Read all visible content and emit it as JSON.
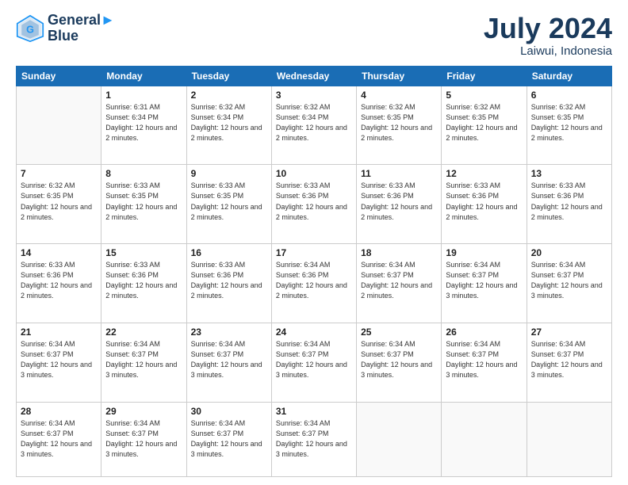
{
  "header": {
    "logo_line1": "General",
    "logo_line2": "Blue",
    "month_year": "July 2024",
    "location": "Laiwui, Indonesia"
  },
  "weekdays": [
    "Sunday",
    "Monday",
    "Tuesday",
    "Wednesday",
    "Thursday",
    "Friday",
    "Saturday"
  ],
  "weeks": [
    [
      {
        "day": "",
        "sunrise": "",
        "sunset": "",
        "daylight": "",
        "empty": true
      },
      {
        "day": "1",
        "sunrise": "6:31 AM",
        "sunset": "6:34 PM",
        "daylight": "12 hours and 2 minutes."
      },
      {
        "day": "2",
        "sunrise": "6:32 AM",
        "sunset": "6:34 PM",
        "daylight": "12 hours and 2 minutes."
      },
      {
        "day": "3",
        "sunrise": "6:32 AM",
        "sunset": "6:34 PM",
        "daylight": "12 hours and 2 minutes."
      },
      {
        "day": "4",
        "sunrise": "6:32 AM",
        "sunset": "6:35 PM",
        "daylight": "12 hours and 2 minutes."
      },
      {
        "day": "5",
        "sunrise": "6:32 AM",
        "sunset": "6:35 PM",
        "daylight": "12 hours and 2 minutes."
      },
      {
        "day": "6",
        "sunrise": "6:32 AM",
        "sunset": "6:35 PM",
        "daylight": "12 hours and 2 minutes."
      }
    ],
    [
      {
        "day": "7",
        "sunrise": "6:32 AM",
        "sunset": "6:35 PM",
        "daylight": "12 hours and 2 minutes."
      },
      {
        "day": "8",
        "sunrise": "6:33 AM",
        "sunset": "6:35 PM",
        "daylight": "12 hours and 2 minutes."
      },
      {
        "day": "9",
        "sunrise": "6:33 AM",
        "sunset": "6:35 PM",
        "daylight": "12 hours and 2 minutes."
      },
      {
        "day": "10",
        "sunrise": "6:33 AM",
        "sunset": "6:36 PM",
        "daylight": "12 hours and 2 minutes."
      },
      {
        "day": "11",
        "sunrise": "6:33 AM",
        "sunset": "6:36 PM",
        "daylight": "12 hours and 2 minutes."
      },
      {
        "day": "12",
        "sunrise": "6:33 AM",
        "sunset": "6:36 PM",
        "daylight": "12 hours and 2 minutes."
      },
      {
        "day": "13",
        "sunrise": "6:33 AM",
        "sunset": "6:36 PM",
        "daylight": "12 hours and 2 minutes."
      }
    ],
    [
      {
        "day": "14",
        "sunrise": "6:33 AM",
        "sunset": "6:36 PM",
        "daylight": "12 hours and 2 minutes."
      },
      {
        "day": "15",
        "sunrise": "6:33 AM",
        "sunset": "6:36 PM",
        "daylight": "12 hours and 2 minutes."
      },
      {
        "day": "16",
        "sunrise": "6:33 AM",
        "sunset": "6:36 PM",
        "daylight": "12 hours and 2 minutes."
      },
      {
        "day": "17",
        "sunrise": "6:34 AM",
        "sunset": "6:36 PM",
        "daylight": "12 hours and 2 minutes."
      },
      {
        "day": "18",
        "sunrise": "6:34 AM",
        "sunset": "6:37 PM",
        "daylight": "12 hours and 2 minutes."
      },
      {
        "day": "19",
        "sunrise": "6:34 AM",
        "sunset": "6:37 PM",
        "daylight": "12 hours and 3 minutes."
      },
      {
        "day": "20",
        "sunrise": "6:34 AM",
        "sunset": "6:37 PM",
        "daylight": "12 hours and 3 minutes."
      }
    ],
    [
      {
        "day": "21",
        "sunrise": "6:34 AM",
        "sunset": "6:37 PM",
        "daylight": "12 hours and 3 minutes."
      },
      {
        "day": "22",
        "sunrise": "6:34 AM",
        "sunset": "6:37 PM",
        "daylight": "12 hours and 3 minutes."
      },
      {
        "day": "23",
        "sunrise": "6:34 AM",
        "sunset": "6:37 PM",
        "daylight": "12 hours and 3 minutes."
      },
      {
        "day": "24",
        "sunrise": "6:34 AM",
        "sunset": "6:37 PM",
        "daylight": "12 hours and 3 minutes."
      },
      {
        "day": "25",
        "sunrise": "6:34 AM",
        "sunset": "6:37 PM",
        "daylight": "12 hours and 3 minutes."
      },
      {
        "day": "26",
        "sunrise": "6:34 AM",
        "sunset": "6:37 PM",
        "daylight": "12 hours and 3 minutes."
      },
      {
        "day": "27",
        "sunrise": "6:34 AM",
        "sunset": "6:37 PM",
        "daylight": "12 hours and 3 minutes."
      }
    ],
    [
      {
        "day": "28",
        "sunrise": "6:34 AM",
        "sunset": "6:37 PM",
        "daylight": "12 hours and 3 minutes."
      },
      {
        "day": "29",
        "sunrise": "6:34 AM",
        "sunset": "6:37 PM",
        "daylight": "12 hours and 3 minutes."
      },
      {
        "day": "30",
        "sunrise": "6:34 AM",
        "sunset": "6:37 PM",
        "daylight": "12 hours and 3 minutes."
      },
      {
        "day": "31",
        "sunrise": "6:34 AM",
        "sunset": "6:37 PM",
        "daylight": "12 hours and 3 minutes."
      },
      {
        "day": "",
        "sunrise": "",
        "sunset": "",
        "daylight": "",
        "empty": true
      },
      {
        "day": "",
        "sunrise": "",
        "sunset": "",
        "daylight": "",
        "empty": true
      },
      {
        "day": "",
        "sunrise": "",
        "sunset": "",
        "daylight": "",
        "empty": true
      }
    ]
  ]
}
